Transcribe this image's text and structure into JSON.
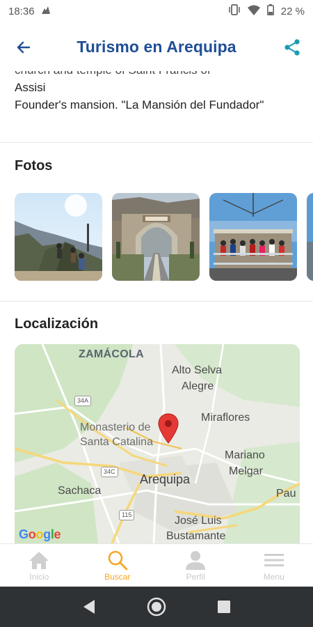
{
  "status_bar": {
    "time": "18:36",
    "battery": "22 %",
    "icons": [
      "notification-icon",
      "vibrate-icon",
      "wifi-icon",
      "battery-icon"
    ]
  },
  "app_bar": {
    "title": "Turismo en Arequipa",
    "back_icon": "arrow-left-icon",
    "share_icon": "share-icon",
    "accent_color": "#1f4e96",
    "share_color": "#1a9bb3"
  },
  "description": {
    "partial_line": "church and temple of Saint Francis of",
    "lines": [
      "Assisi",
      "Founder's mansion. \"La Mansión del Fundador\""
    ]
  },
  "photos": {
    "title": "Fotos",
    "items": [
      {
        "alt": "mountain-viewpoint-photo"
      },
      {
        "alt": "stone-arch-photo"
      },
      {
        "alt": "tourist-platform-photo"
      },
      {
        "alt": "partial-photo"
      }
    ]
  },
  "location": {
    "title": "Localización",
    "map": {
      "labels": {
        "zamacola": "ZAMÁCOLA",
        "alto_selva_alegre_1": "Alto Selva",
        "alto_selva_alegre_2": "Alegre",
        "miraflores": "Miraflores",
        "monasterio_1": "Monasterio de",
        "monasterio_2": "Santa Catalina",
        "mariano_1": "Mariano",
        "mariano_2": "Melgar",
        "sachaca": "Sachaca",
        "arequipa": "Arequipa",
        "jose_luis_1": "José Luis",
        "jose_luis_2": "Bustamante",
        "pau": "Pau"
      },
      "routes": [
        "34A",
        "34C",
        "115"
      ],
      "logo": "Google",
      "pin_color": "#e53935"
    }
  },
  "bottom_nav": {
    "active_color": "#f5a623",
    "items": [
      {
        "label": "Inicio",
        "icon": "home-icon"
      },
      {
        "label": "Buscar",
        "icon": "search-icon"
      },
      {
        "label": "Perfil",
        "icon": "person-icon"
      },
      {
        "label": "Menu",
        "icon": "menu-icon"
      }
    ]
  },
  "system_nav": {
    "icons": [
      "back-triangle-icon",
      "home-circle-icon",
      "recents-square-icon"
    ]
  }
}
